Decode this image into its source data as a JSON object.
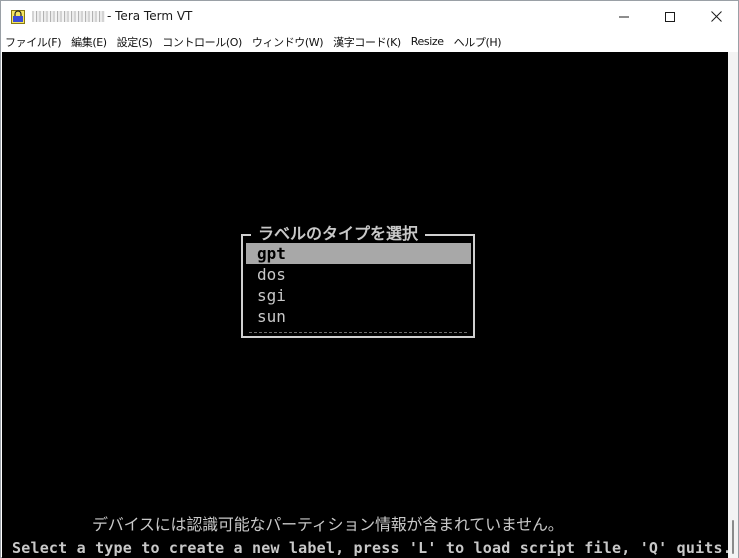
{
  "window": {
    "title": "- Tera Term VT",
    "icon": "tera-term-app-icon"
  },
  "menu": [
    {
      "label": "ファイル(F)"
    },
    {
      "label": "編集(E)"
    },
    {
      "label": "設定(S)"
    },
    {
      "label": "コントロール(O)"
    },
    {
      "label": "ウィンドウ(W)"
    },
    {
      "label": "漢字コード(K)"
    },
    {
      "label": "Resize"
    },
    {
      "label": "ヘルプ(H)"
    }
  ],
  "dialog": {
    "title": "ラベルのタイプを選択",
    "options": [
      {
        "label": "gpt",
        "selected": true
      },
      {
        "label": "dos",
        "selected": false
      },
      {
        "label": "sgi",
        "selected": false
      },
      {
        "label": "sun",
        "selected": false
      }
    ]
  },
  "message": "デバイスには認識可能なパーティション情報が含まれていません。",
  "status": "Select a type to create a new label, press 'L' to load script file, 'Q' quits.",
  "colors": {
    "terminal_bg": "#000000",
    "terminal_fg": "#c8c8c8",
    "selection_bg": "#a8a8a8"
  }
}
